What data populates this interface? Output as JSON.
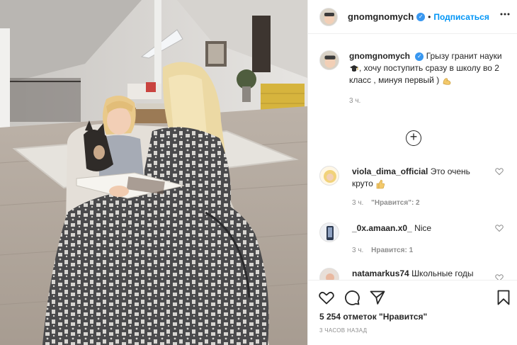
{
  "header": {
    "username": "gnomgnomych",
    "verified_mark": "✓",
    "separator": "•",
    "follow_label": "Подписаться",
    "more_icon": "more-horizontal-icon"
  },
  "caption": {
    "username": "gnomgnomych",
    "text_before": "Грызу гранит науки ",
    "text_middle": ", хочу поступить сразу в школу во 2 класс , минуя первый )",
    "time": "3 ч."
  },
  "load_more": {
    "icon": "plus-circle-icon",
    "symbol": "+"
  },
  "comments": [
    {
      "username": "viola_dima_official",
      "text": "Это очень круто",
      "time": "3 ч.",
      "likes": "\"Нравится\": 2"
    },
    {
      "username": "_0x.amaan.x0_",
      "text": "Nice",
      "time": "3 ч.",
      "likes": "Нравится: 1"
    },
    {
      "username": "natamarkus74",
      "text": "Школьные годы",
      "time": "",
      "likes": ""
    }
  ],
  "actions": {
    "likes_count": "5 254 отметок \"Нравится\"",
    "post_time": "3 ЧАСОВ НАЗАД"
  },
  "colors": {
    "accent": "#0095f6",
    "verified": "#3897f0",
    "text": "#262626",
    "secondary_text": "#8e8e8e",
    "border": "#efefef"
  }
}
